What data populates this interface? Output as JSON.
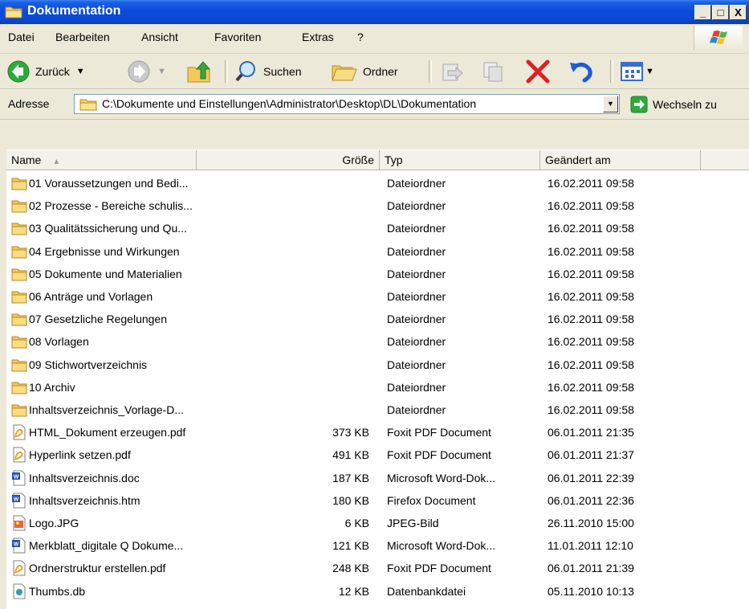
{
  "window": {
    "title": "Dokumentation"
  },
  "caption_buttons": {
    "minimize": "_",
    "maximize": "□",
    "close": "X"
  },
  "menu": [
    "Datei",
    "Bearbeiten",
    "Ansicht",
    "Favoriten",
    "Extras",
    "?"
  ],
  "toolbar": {
    "back": "Zurück",
    "search": "Suchen",
    "folders": "Ordner"
  },
  "address": {
    "label": "Adresse",
    "path": "C:\\Dokumente und Einstellungen\\Administrator\\Desktop\\DL\\Dokumentation",
    "go": "Wechseln zu"
  },
  "columns": {
    "name": "Name",
    "size": "Größe",
    "type": "Typ",
    "modified": "Geändert am"
  },
  "files": [
    {
      "icon": "folder-icon",
      "name": "01 Voraussetzungen und Bedi...",
      "size": "",
      "type": "Dateiordner",
      "date": "16.02.2011 09:58"
    },
    {
      "icon": "folder-icon",
      "name": "02 Prozesse - Bereiche schulis...",
      "size": "",
      "type": "Dateiordner",
      "date": "16.02.2011 09:58"
    },
    {
      "icon": "folder-icon",
      "name": "03 Qualitätssicherung und Qu...",
      "size": "",
      "type": "Dateiordner",
      "date": "16.02.2011 09:58"
    },
    {
      "icon": "folder-icon",
      "name": "04 Ergebnisse und Wirkungen",
      "size": "",
      "type": "Dateiordner",
      "date": "16.02.2011 09:58"
    },
    {
      "icon": "folder-icon",
      "name": "05 Dokumente und Materialien",
      "size": "",
      "type": "Dateiordner",
      "date": "16.02.2011 09:58"
    },
    {
      "icon": "folder-icon",
      "name": "06 Anträge und Vorlagen",
      "size": "",
      "type": "Dateiordner",
      "date": "16.02.2011 09:58"
    },
    {
      "icon": "folder-icon",
      "name": "07 Gesetzliche Regelungen",
      "size": "",
      "type": "Dateiordner",
      "date": "16.02.2011 09:58"
    },
    {
      "icon": "folder-icon",
      "name": "08 Vorlagen",
      "size": "",
      "type": "Dateiordner",
      "date": "16.02.2011 09:58"
    },
    {
      "icon": "folder-icon",
      "name": "09 Stichwortverzeichnis",
      "size": "",
      "type": "Dateiordner",
      "date": "16.02.2011 09:58"
    },
    {
      "icon": "folder-icon",
      "name": "10 Archiv",
      "size": "",
      "type": "Dateiordner",
      "date": "16.02.2011 09:58"
    },
    {
      "icon": "folder-icon",
      "name": "Inhaltsverzeichnis_Vorlage-D...",
      "size": "",
      "type": "Dateiordner",
      "date": "16.02.2011 09:58"
    },
    {
      "icon": "pdf-icon",
      "name": "HTML_Dokument erzeugen.pdf",
      "size": "373 KB",
      "type": "Foxit PDF Document",
      "date": "06.01.2011 21:35"
    },
    {
      "icon": "pdf-icon",
      "name": "Hyperlink setzen.pdf",
      "size": "491 KB",
      "type": "Foxit PDF Document",
      "date": "06.01.2011 21:37"
    },
    {
      "icon": "word-icon",
      "name": "Inhaltsverzeichnis.doc",
      "size": "187 KB",
      "type": "Microsoft Word-Dok...",
      "date": "06.01.2011 22:39"
    },
    {
      "icon": "word-icon",
      "name": "Inhaltsverzeichnis.htm",
      "size": "180 KB",
      "type": "Firefox Document",
      "date": "06.01.2011 22:36"
    },
    {
      "icon": "image-icon",
      "name": "Logo.JPG",
      "size": "6 KB",
      "type": "JPEG-Bild",
      "date": "26.11.2010 15:00"
    },
    {
      "icon": "word-icon",
      "name": "Merkblatt_digitale Q Dokume...",
      "size": "121 KB",
      "type": "Microsoft Word-Dok...",
      "date": "11.01.2011 12:10"
    },
    {
      "icon": "pdf-icon",
      "name": "Ordnerstruktur erstellen.pdf",
      "size": "248 KB",
      "type": "Foxit PDF Document",
      "date": "06.01.2011 21:39"
    },
    {
      "icon": "db-icon",
      "name": "Thumbs.db",
      "size": "12 KB",
      "type": "Datenbankdatei",
      "date": "05.11.2010 10:13"
    }
  ]
}
